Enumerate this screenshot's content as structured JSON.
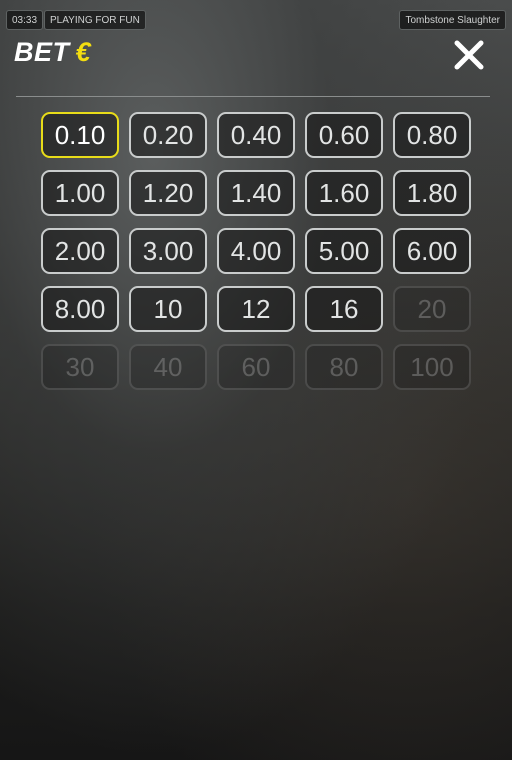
{
  "status": {
    "clock": "03:33",
    "mode": "PLAYING FOR FUN",
    "game": "Tombstone Slaughter"
  },
  "header": {
    "title": "BET",
    "currency": "€",
    "close_icon": "close-icon"
  },
  "colors": {
    "selected_border": "#e8dc19",
    "currency": "#f3dd10"
  },
  "bets": [
    {
      "label": "0.10",
      "state": "selected"
    },
    {
      "label": "0.20",
      "state": "enabled"
    },
    {
      "label": "0.40",
      "state": "enabled"
    },
    {
      "label": "0.60",
      "state": "enabled"
    },
    {
      "label": "0.80",
      "state": "enabled"
    },
    {
      "label": "1.00",
      "state": "enabled"
    },
    {
      "label": "1.20",
      "state": "enabled"
    },
    {
      "label": "1.40",
      "state": "enabled"
    },
    {
      "label": "1.60",
      "state": "enabled"
    },
    {
      "label": "1.80",
      "state": "enabled"
    },
    {
      "label": "2.00",
      "state": "enabled"
    },
    {
      "label": "3.00",
      "state": "enabled"
    },
    {
      "label": "4.00",
      "state": "enabled"
    },
    {
      "label": "5.00",
      "state": "enabled"
    },
    {
      "label": "6.00",
      "state": "enabled"
    },
    {
      "label": "8.00",
      "state": "enabled"
    },
    {
      "label": "10",
      "state": "enabled"
    },
    {
      "label": "12",
      "state": "enabled"
    },
    {
      "label": "16",
      "state": "enabled"
    },
    {
      "label": "20",
      "state": "disabled"
    },
    {
      "label": "30",
      "state": "disabled"
    },
    {
      "label": "40",
      "state": "disabled"
    },
    {
      "label": "60",
      "state": "disabled"
    },
    {
      "label": "80",
      "state": "disabled"
    },
    {
      "label": "100",
      "state": "disabled"
    }
  ]
}
